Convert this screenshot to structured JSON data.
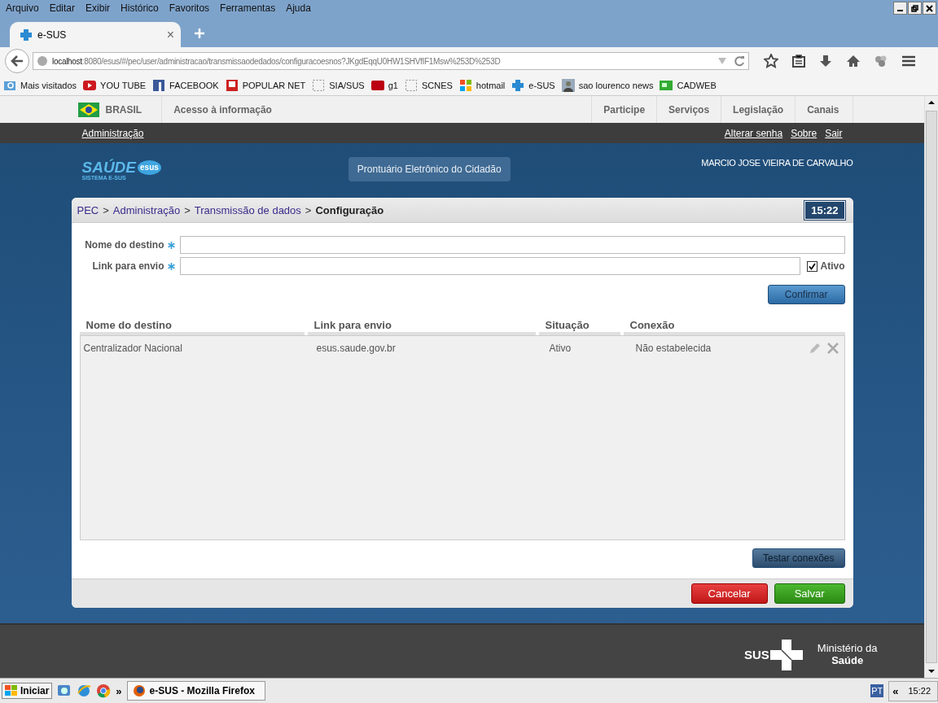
{
  "browser": {
    "menu": [
      "Arquivo",
      "Editar",
      "Exibir",
      "Histórico",
      "Favoritos",
      "Ferramentas",
      "Ajuda"
    ],
    "tab": {
      "title": "e-SUS",
      "close": "×",
      "selected": true
    },
    "url": {
      "host": "localhost",
      "path": ":8080/esus/#/pec/user/administracao/transmissaodedados/configuracoesnos?JKgdEqqU0HW1SHVfIF1Msw%253D%253D"
    },
    "bookmarks": [
      {
        "label": "Mais visitados",
        "kind": "folder"
      },
      {
        "label": "YOU TUBE",
        "kind": "play"
      },
      {
        "label": "FACEBOOK",
        "kind": "tile"
      },
      {
        "label": "POPULAR NET",
        "kind": "window"
      },
      {
        "label": "SIA/SUS",
        "kind": "blank"
      },
      {
        "label": "g1",
        "kind": "badge"
      },
      {
        "label": "SCNES",
        "kind": "blank"
      },
      {
        "label": "hotmail",
        "kind": "squares"
      },
      {
        "label": "e-SUS",
        "kind": "cross"
      },
      {
        "label": "sao lourenco news",
        "kind": "person"
      },
      {
        "label": "CADWEB",
        "kind": "card"
      }
    ]
  },
  "gov_bar": {
    "country": "BRASIL",
    "access": "Acesso à informação",
    "links": [
      "Participe",
      "Serviços",
      "Legislação",
      "Canais"
    ]
  },
  "user_bar": {
    "section": "Administração",
    "links": [
      "Alterar senha",
      "Sobre",
      "Sair"
    ]
  },
  "header": {
    "logo": {
      "title": "SAÚDE",
      "badge": "esus",
      "subtitle": "SISTEMA E-SUS"
    },
    "app_name": "Prontuário Eletrônico do Cidadão",
    "user": "MARCIO JOSE VIEIRA DE CARVALHO"
  },
  "breadcrumb": {
    "separator": ">",
    "items": [
      "PEC",
      "Administração",
      "Transmissão de dados"
    ],
    "current": "Configuração",
    "time": "15:22"
  },
  "form": {
    "fields": [
      {
        "label": "Nome do destino",
        "required": true
      },
      {
        "label": "Link para envio",
        "required": true
      }
    ],
    "active": {
      "label": "Ativo",
      "checked": true
    },
    "confirm": "Confirmar"
  },
  "table": {
    "columns": [
      "Nome do destino",
      "Link para envio",
      "Situação",
      "Conexão"
    ],
    "rows": [
      {
        "cells": [
          "Centralizador Nacional",
          "esus.saude.gov.br",
          "Ativo",
          "Não estabelecida"
        ]
      }
    ]
  },
  "test_button": "Testar conexões",
  "actions": [
    {
      "label": "Cancelar",
      "kind": "danger"
    },
    {
      "label": "Salvar",
      "kind": "success"
    }
  ],
  "footer": {
    "sus": "SUS",
    "ministry": [
      "Ministério da",
      "Saúde"
    ]
  },
  "taskbar": {
    "start": "Iniciar",
    "more": "»",
    "window": "e-SUS - Mozilla Firefox",
    "lang": "PT",
    "collapse": "«",
    "clock": "15:22"
  }
}
